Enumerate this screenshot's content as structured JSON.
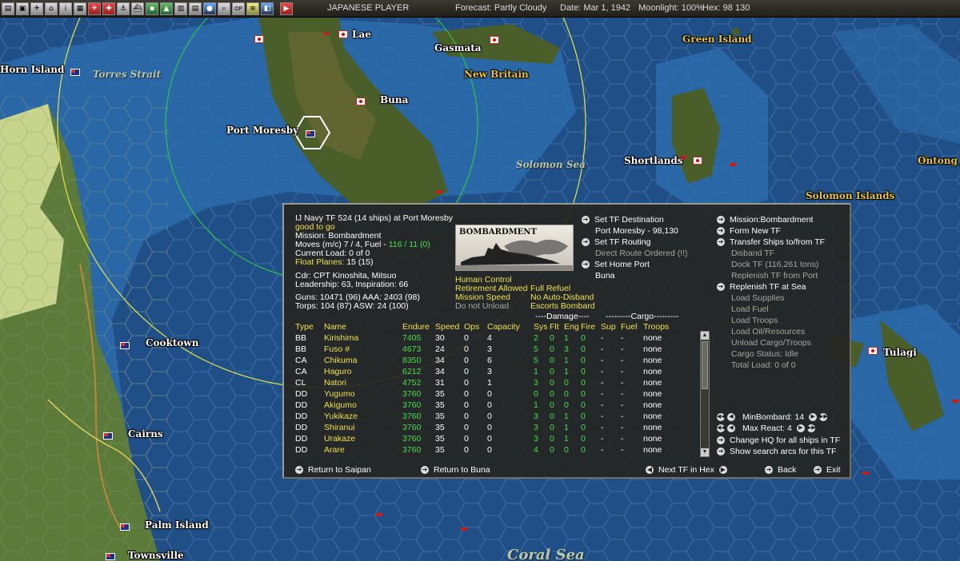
{
  "topbar": {
    "buttons": [
      "menu",
      "orders",
      "air",
      "ground",
      "info",
      "map-layers",
      "aircraft",
      "naval-aircraft",
      "naval",
      "ships",
      "cities",
      "terrain",
      "bases",
      "units",
      "globe",
      "search",
      "op",
      "report",
      "reinforce",
      "end-turn"
    ],
    "player": "JAPANESE PLAYER",
    "forecast": "Forecast: Partly Cloudy",
    "date": "Date: Mar 1, 1942",
    "moonlight": "Moonlight: 100%",
    "hex": "Hex: 98 130"
  },
  "map_labels": {
    "lae": "Lae",
    "gasmata": "Gasmata",
    "green_island": "Green Island",
    "horn_island": "Horn Island",
    "torres_strait": "Torres Strait",
    "new_britain": "New Britain",
    "buna": "Buna",
    "port_moresby": "Port Moresby",
    "solomon_sea": "Solomon Sea",
    "shortlands": "Shortlands",
    "ontong": "Ontong J",
    "solomon_islands": "Solomon Islands",
    "tulagi": "Tulagi",
    "cooktown": "Cooktown",
    "cairns": "Cairns",
    "palm_island": "Palm Island",
    "townsville": "Townsville",
    "coral_sea": "Coral Sea"
  },
  "panel": {
    "header": "IJ Navy TF 524 (14 ships) at Port Moresby",
    "status": "good to go",
    "mission": "Mission: Bombardment",
    "moves_prefix": "Moves (m/c) 7 / 4, Fuel - ",
    "moves_fuel": "116 / 11 (0)",
    "current_load": "Current Load: 0 of 0",
    "float_planes_label": "Float Planes:",
    "float_planes_value": "15 (15)",
    "cdr": "Cdr: CPT Kinoshita, Mitsuo",
    "leadership": "Leadership: 63, Inspiration: 66",
    "guns": "Guns: 10471 (96)  AAA: 2403 (98)",
    "torps": "Torps: 104 (87)    ASW: 24 (100)",
    "mission_image_caption": "BOMBARDMENT",
    "settings": {
      "human_control": "Human Control",
      "retirement": "Retirement Allowed",
      "full_refuel": "Full Refuel",
      "mission_speed": "Mission Speed",
      "no_auto_disband": "No Auto-Disband",
      "do_not_unload": "Do not Unload",
      "escorts_bombard": "Escorts Bombard"
    },
    "mid_actions": {
      "set_destination": "Set TF Destination",
      "destination_value": "Port Moresby - 98,130",
      "set_routing": "Set TF Routing",
      "routing_value": "Direct Route Ordered (!!)",
      "set_home": "Set Home Port",
      "home_value": "Buna"
    },
    "right_actions": [
      {
        "label": "Mission:Bombardment",
        "enabled": true,
        "arrow": true
      },
      {
        "label": "Form New TF",
        "enabled": true,
        "arrow": true
      },
      {
        "label": "Transfer Ships to/from TF",
        "enabled": true,
        "arrow": true
      },
      {
        "label": "Disband TF",
        "enabled": false,
        "arrow": false
      },
      {
        "label": "Dock TF (116,261 tons)",
        "enabled": false,
        "arrow": false
      },
      {
        "label": "Replenish TF from Port",
        "enabled": false,
        "arrow": false
      },
      {
        "label": "Replenish TF at Sea",
        "enabled": true,
        "arrow": true
      },
      {
        "label": "Load Supplies",
        "enabled": false,
        "arrow": false
      },
      {
        "label": "Load Fuel",
        "enabled": false,
        "arrow": false
      },
      {
        "label": "Load Troops",
        "enabled": false,
        "arrow": false
      },
      {
        "label": "Load Oil/Resources",
        "enabled": false,
        "arrow": false
      },
      {
        "label": "Unload Cargo/Troops",
        "enabled": false,
        "arrow": false
      },
      {
        "label": "Cargo Status: Idle",
        "enabled": false,
        "arrow": false
      },
      {
        "label": "Total Load: 0 of 0",
        "enabled": false,
        "arrow": false
      }
    ],
    "min_bombard": "MinBombard: 14",
    "max_react": "Max React: 4",
    "change_hq": "Change HQ for all ships in TF",
    "show_arcs": "Show search arcs for this TF",
    "group_headers": {
      "damage": "----Damage----",
      "cargo": "---------Cargo---------"
    },
    "columns": [
      "Type",
      "Name",
      "Endure",
      "Speed",
      "Ops",
      "Capacity",
      "Sys",
      "Flt",
      "Eng",
      "Fire",
      "Sup",
      "Fuel",
      "Troops"
    ],
    "ships": [
      [
        "BB",
        "Kirishima",
        "7405",
        "30",
        "0",
        "4",
        "2",
        "0",
        "1",
        "0",
        "-",
        "-",
        "none"
      ],
      [
        "BB",
        "Fuso #",
        "4673",
        "24",
        "0",
        "3",
        "5",
        "0",
        "3",
        "0",
        "-",
        "-",
        "none"
      ],
      [
        "CA",
        "Chikuma",
        "8350",
        "34",
        "0",
        "6",
        "5",
        "0",
        "1",
        "0",
        "-",
        "-",
        "none"
      ],
      [
        "CA",
        "Haguro",
        "6212",
        "34",
        "0",
        "3",
        "1",
        "0",
        "1",
        "0",
        "-",
        "-",
        "none"
      ],
      [
        "CL",
        "Natori",
        "4752",
        "31",
        "0",
        "1",
        "3",
        "0",
        "0",
        "0",
        "-",
        "-",
        "none"
      ],
      [
        "DD",
        "Yugumo",
        "3760",
        "35",
        "0",
        "0",
        "0",
        "0",
        "0",
        "0",
        "-",
        "-",
        "none"
      ],
      [
        "DD",
        "Akigumo",
        "3760",
        "35",
        "0",
        "0",
        "1",
        "0",
        "0",
        "0",
        "-",
        "-",
        "none"
      ],
      [
        "DD",
        "Yukikaze",
        "3760",
        "35",
        "0",
        "0",
        "3",
        "0",
        "1",
        "0",
        "-",
        "-",
        "none"
      ],
      [
        "DD",
        "Shiranui",
        "3760",
        "35",
        "0",
        "0",
        "3",
        "0",
        "1",
        "0",
        "-",
        "-",
        "none"
      ],
      [
        "DD",
        "Urakaze",
        "3760",
        "35",
        "0",
        "0",
        "3",
        "0",
        "1",
        "0",
        "-",
        "-",
        "none"
      ],
      [
        "DD",
        "Arare",
        "3760",
        "35",
        "0",
        "0",
        "4",
        "0",
        "0",
        "0",
        "-",
        "-",
        "none"
      ]
    ],
    "bottom": {
      "return_saipan": "Return to Saipan",
      "return_buna": "Return to Buna",
      "next_tf": "Next TF in Hex",
      "back": "Back",
      "exit": "Exit"
    }
  }
}
